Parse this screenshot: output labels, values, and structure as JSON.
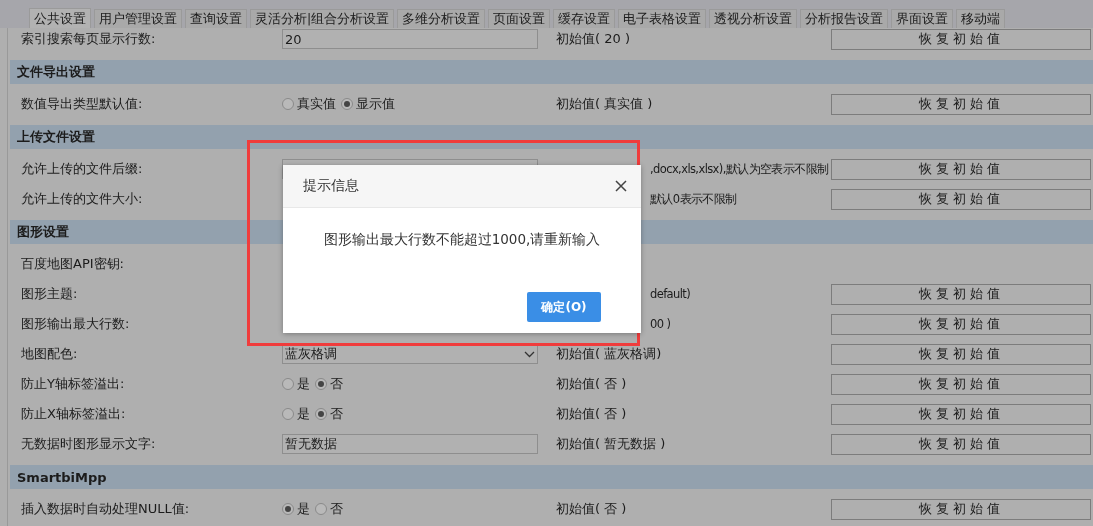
{
  "tabs": [
    {
      "label": "公共设置",
      "selected": true
    },
    {
      "label": "用户管理设置",
      "selected": false
    },
    {
      "label": "查询设置",
      "selected": false
    },
    {
      "label": "灵活分析|组合分析设置",
      "selected": false
    },
    {
      "label": "多维分析设置",
      "selected": false
    },
    {
      "label": "页面设置",
      "selected": false
    },
    {
      "label": "缓存设置",
      "selected": false
    },
    {
      "label": "电子表格设置",
      "selected": false
    },
    {
      "label": "透视分析设置",
      "selected": false
    },
    {
      "label": "分析报告设置",
      "selected": false
    },
    {
      "label": "界面设置",
      "selected": false
    },
    {
      "label": "移动端",
      "selected": false
    }
  ],
  "sections": [
    {
      "rows": [
        {
          "label": "索引搜索每页显示行数:",
          "kind": "text",
          "value": "20",
          "initial": "初始值( 20 )",
          "button": "恢复初始值"
        }
      ]
    },
    {
      "title": "文件导出设置",
      "rows": [
        {
          "label": "数值导出类型默认值:",
          "kind": "radio",
          "options": [
            {
              "label": "真实值",
              "selected": false
            },
            {
              "label": "显示值",
              "selected": true
            }
          ],
          "initial": "初始值( 真实值 )",
          "button": "恢复初始值"
        }
      ]
    },
    {
      "title": "上传文件设置",
      "rows": [
        {
          "label": "允许上传的文件后缀:",
          "kind": "text",
          "hint": ",docx,xls,xlsx),默认为空表示不限制",
          "covered": true,
          "button": "恢复初始值"
        },
        {
          "label": "允许上传的文件大小:",
          "kind": "hidden",
          "hint": "默认0表示不限制",
          "covered": true,
          "button": "恢复初始值"
        }
      ]
    },
    {
      "title": "图形设置",
      "rows": [
        {
          "label": "百度地图API密钥:",
          "kind": "hidden"
        },
        {
          "label": "图形主题:",
          "kind": "hidden",
          "initial": "default)",
          "covered": true,
          "button": "恢复初始值"
        },
        {
          "label": "图形输出最大行数:",
          "kind": "hidden",
          "initial": "00 )",
          "covered": true,
          "button": "恢复初始值"
        },
        {
          "label": "地图配色:",
          "kind": "select",
          "value": "蓝灰格调",
          "initial": "初始值( 蓝灰格调)",
          "button": "恢复初始值"
        },
        {
          "label": "防止Y轴标签溢出:",
          "kind": "radio",
          "options": [
            {
              "label": "是",
              "selected": false
            },
            {
              "label": "否",
              "selected": true
            }
          ],
          "initial": "初始值( 否 )",
          "button": "恢复初始值"
        },
        {
          "label": "防止X轴标签溢出:",
          "kind": "radio",
          "options": [
            {
              "label": "是",
              "selected": false
            },
            {
              "label": "否",
              "selected": true
            }
          ],
          "initial": "初始值( 否 )",
          "button": "恢复初始值"
        },
        {
          "label": "无数据时图形显示文字:",
          "kind": "text",
          "value": "暂无数据",
          "initial": "初始值( 暂无数据 )",
          "button": "恢复初始值"
        }
      ]
    },
    {
      "title": "SmartbiMpp",
      "rows": [
        {
          "label": "插入数据时自动处理NULL值:",
          "kind": "radio",
          "options": [
            {
              "label": "是",
              "selected": true
            },
            {
              "label": "否",
              "selected": false
            }
          ],
          "initial": "初始值( 否 )",
          "button": "恢复初始值"
        }
      ]
    }
  ],
  "dialog": {
    "title": "提示信息",
    "message": "图形输出最大行数不能超过1000,请重新输入",
    "ok": "确定(O)"
  }
}
